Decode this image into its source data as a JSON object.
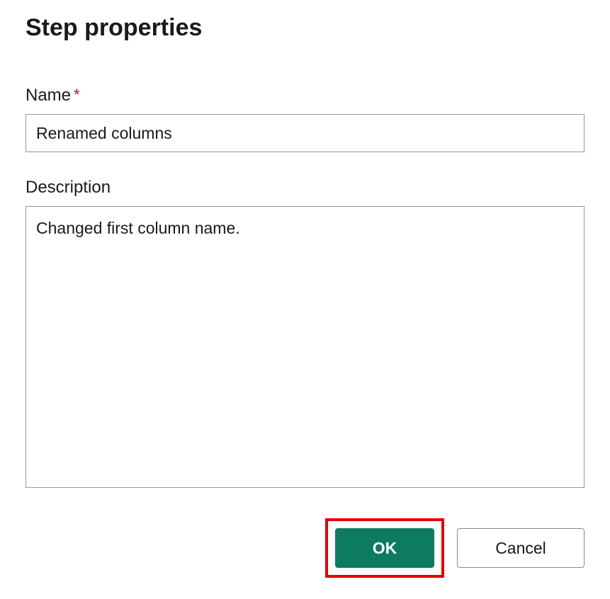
{
  "dialog": {
    "title": "Step properties"
  },
  "fields": {
    "name": {
      "label": "Name",
      "required_indicator": "*",
      "value": "Renamed columns"
    },
    "description": {
      "label": "Description",
      "value": "Changed first column name."
    }
  },
  "buttons": {
    "ok": "OK",
    "cancel": "Cancel"
  },
  "colors": {
    "primary_button_bg": "#0d7b5f",
    "required_star": "#c50f1f",
    "highlight_border": "#e20000"
  }
}
